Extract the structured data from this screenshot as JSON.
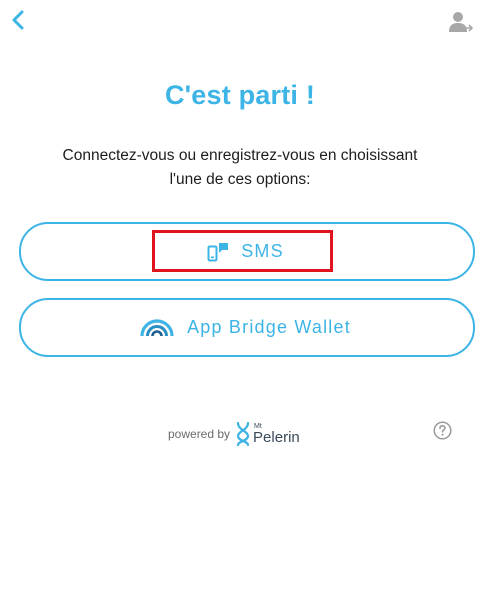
{
  "header": {
    "back_icon": "chevron-left-icon",
    "user_icon": "user-sign-in-icon"
  },
  "main": {
    "title": "C'est parti !",
    "subtitle_line1": "Connectez-vous ou enregistrez-vous en choisissant",
    "subtitle_line2": "l'une de ces options:"
  },
  "options": {
    "sms": {
      "label": "SMS",
      "icon": "mobile-sms-icon"
    },
    "wallet": {
      "label": "App Bridge Wallet",
      "icon": "bridge-wallet-icon"
    }
  },
  "footer": {
    "powered_by": "powered by",
    "logo_small": "Mt",
    "logo_big": "Pelerin",
    "help_icon": "question-circle-icon"
  },
  "colors": {
    "accent": "#3cb4e6",
    "highlight": "#e0141e",
    "text": "#1d1d1d"
  }
}
